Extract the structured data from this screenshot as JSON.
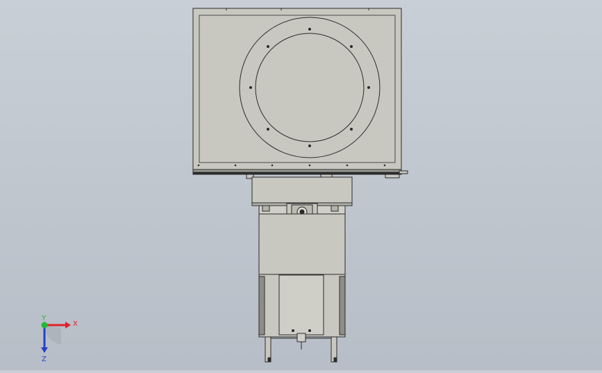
{
  "viewport": {
    "background_top": "#c9cfd6",
    "background_bottom": "#b7bec7",
    "part_face_color": "#c8c8c0",
    "edge_color": "#2a2a2a"
  },
  "triad": {
    "x_label": "X",
    "y_label": "Y",
    "z_label": "Z",
    "x_color": "#e0202a",
    "y_color": "#22b83a",
    "z_color": "#2540c8"
  }
}
